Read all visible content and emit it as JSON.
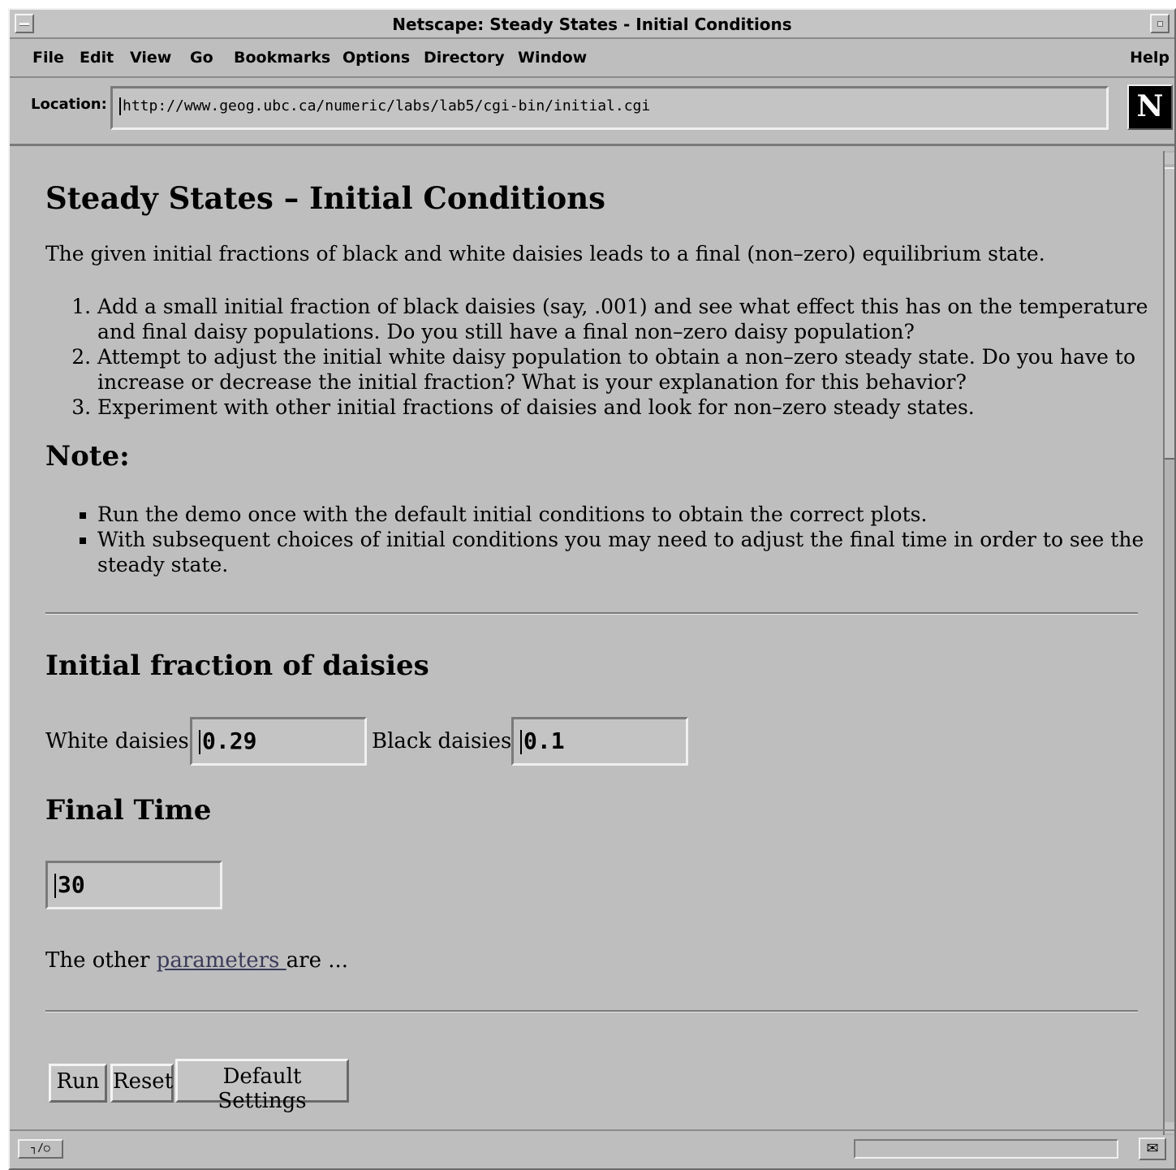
{
  "window": {
    "title": "Netscape: Steady States  -  Initial Conditions"
  },
  "menu": [
    "File",
    "Edit",
    "View",
    "Go",
    "Bookmarks",
    "Options",
    "Directory",
    "Window"
  ],
  "help": "Help",
  "location": {
    "label": "Location:",
    "url": "http://www.geog.ubc.ca/numeric/labs/lab5/cgi-bin/initial.cgi"
  },
  "logo": "N",
  "page": {
    "heading": "Steady States – Initial Conditions",
    "intro": "The given initial fractions of black and white daisies leads to a final (non–zero) equilibrium state.",
    "tasks": [
      "Add a small initial fraction of black daisies (say, .001) and see what effect this has on the temperature and final daisy populations. Do you still have a final non–zero daisy population?",
      "Attempt to adjust the initial white daisy population to obtain a non–zero steady state. Do you have to increase or decrease the initial fraction? What is your explanation for this behavior?",
      "Experiment with other initial fractions of daisies and look for non–zero steady states."
    ],
    "note_heading": "Note:",
    "notes": [
      "Run the demo once with the default initial conditions to obtain the correct plots.",
      "With subsequent choices of initial conditions you may need to adjust the final time in order to see the steady state."
    ],
    "fraction_heading": "Initial fraction of daisies",
    "white_label": "White daisies :",
    "white_value": "0.29",
    "black_label": "Black daisies :",
    "black_value": "0.1",
    "time_heading": "Final Time",
    "time_value": "30",
    "other_prefix": "The other ",
    "other_link": "parameters ",
    "other_suffix": "are ...",
    "buttons": {
      "run": "Run",
      "reset": "Reset",
      "defaults": "Default Settings"
    }
  },
  "status": {
    "icon": "┐/○",
    "mail_icon": "✉"
  }
}
